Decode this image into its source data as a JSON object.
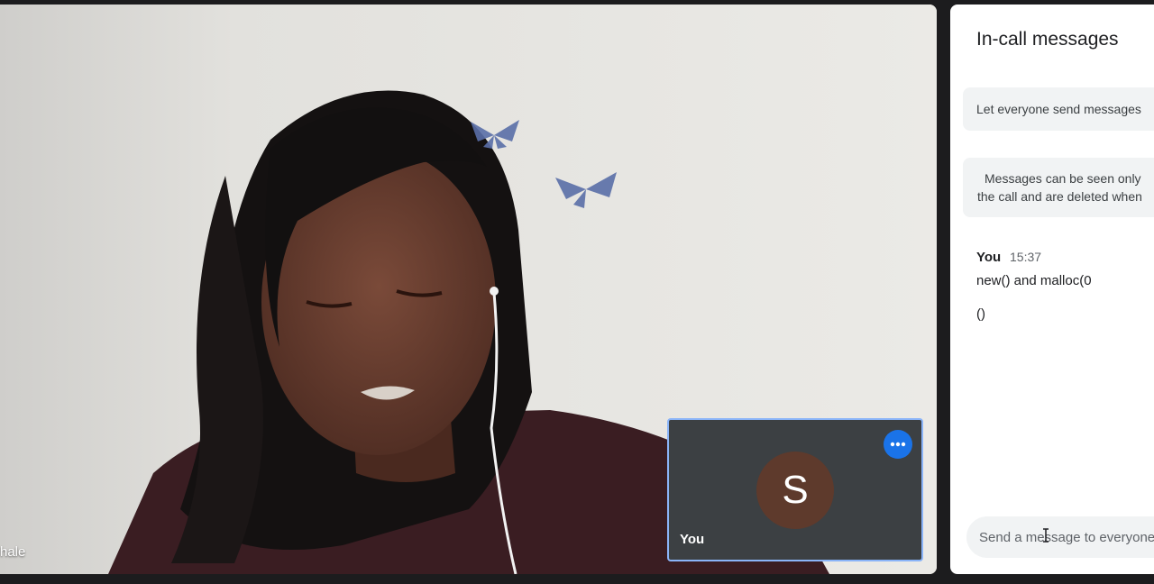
{
  "main_video": {
    "participant_name_partial": "hale"
  },
  "self_view": {
    "avatar_initial": "S",
    "name": "You",
    "more_options_icon": "more-horizontal-icon",
    "more_options_color": "#1a73e8",
    "avatar_color": "#5e3a2c"
  },
  "chat": {
    "title": "In-call messages",
    "toggle_label": "Let everyone send messages",
    "info_line_1": "Messages can be seen only",
    "info_line_2": "the call and are deleted when",
    "messages": [
      {
        "sender": "You",
        "time": "15:37",
        "lines": [
          "new() and malloc(0",
          "()"
        ]
      }
    ],
    "input_placeholder": "Send a message to everyone"
  }
}
